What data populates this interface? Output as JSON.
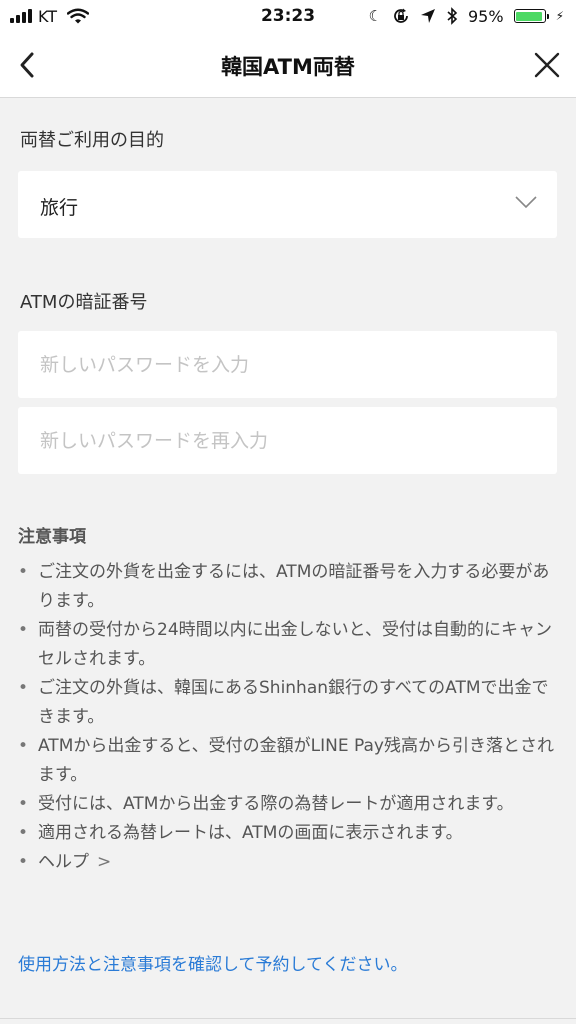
{
  "status_bar": {
    "carrier": "KT",
    "time": "23:23",
    "battery_percent": "95%",
    "battery_level": 0.95,
    "icons": [
      "signal-icon",
      "wifi-icon",
      "moon-icon",
      "lock-rotation-icon",
      "location-icon",
      "bluetooth-icon",
      "battery-icon",
      "charging-icon"
    ]
  },
  "header": {
    "title": "韓国ATM両替",
    "back_icon": "chevron-left-icon",
    "close_icon": "close-icon"
  },
  "purpose": {
    "label": "両替ご利用の目的",
    "selected": "旅行",
    "dropdown_icon": "chevron-down-icon"
  },
  "pin": {
    "label": "ATMの暗証番号",
    "new_placeholder": "新しいパスワードを入力",
    "confirm_placeholder": "新しいパスワードを再入力"
  },
  "notes": {
    "title": "注意事項",
    "items": [
      "ご注文の外貨を出金するには、ATMの暗証番号を入力する必要があります。",
      "両替の受付から24時間以内に出金しないと、受付は自動的にキャンセルされます。",
      "ご注文の外貨は、韓国にあるShinhan銀行のすべてのATMで出金できます。",
      "ATMから出金すると、受付の金額がLINE Pay残高から引き落とされます。",
      "受付には、ATMから出金する際の為替レートが適用されます。",
      "適用される為替レートは、ATMの画面に表示されます。"
    ],
    "help": "ヘルプ",
    "bullet": "•",
    "help_arrow": ">"
  },
  "footer": {
    "confirm_text": "使用方法と注意事項を確認して予約してください。"
  },
  "colors": {
    "background": "#f2f2f2",
    "link": "#2a7bd6",
    "battery_fill": "#4cd964",
    "placeholder": "#c4c4c4"
  }
}
